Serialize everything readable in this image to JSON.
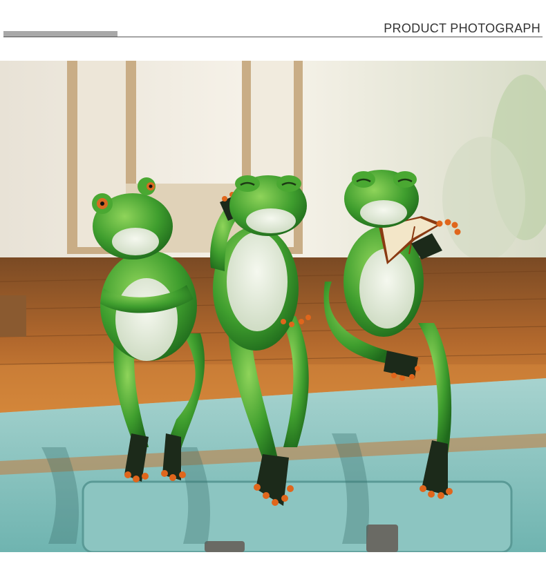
{
  "header": {
    "title": "PRODUCT PHOTOGRAPH",
    "accent_color": "#a8a8a8",
    "line_color": "#555555"
  },
  "photo": {
    "subject": "three-frog-figurines-on-wooden-shelf",
    "colors": {
      "frog_green": "#3f9e2e",
      "frog_belly": "#e6ece0",
      "toe_orange": "#e0661c",
      "wood": "#b86a2e",
      "drawer": "#5fa9a6"
    }
  }
}
